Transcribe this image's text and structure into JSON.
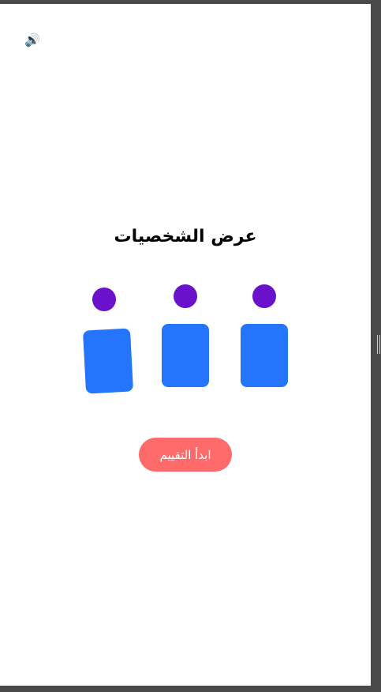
{
  "sound": {
    "icon": "speaker-icon",
    "glyph": "🔊"
  },
  "title": "عرض الشخصيات",
  "characters": [
    {
      "head_color": "#6a11cb",
      "body_color": "#2575fc",
      "tilt_deg": -3
    },
    {
      "head_color": "#6a11cb",
      "body_color": "#2575fc",
      "tilt_deg": 0
    },
    {
      "head_color": "#6a11cb",
      "body_color": "#2575fc",
      "tilt_deg": 0
    }
  ],
  "start_button": {
    "label": "ابدأ التقييم",
    "color": "#ff6b6b"
  }
}
